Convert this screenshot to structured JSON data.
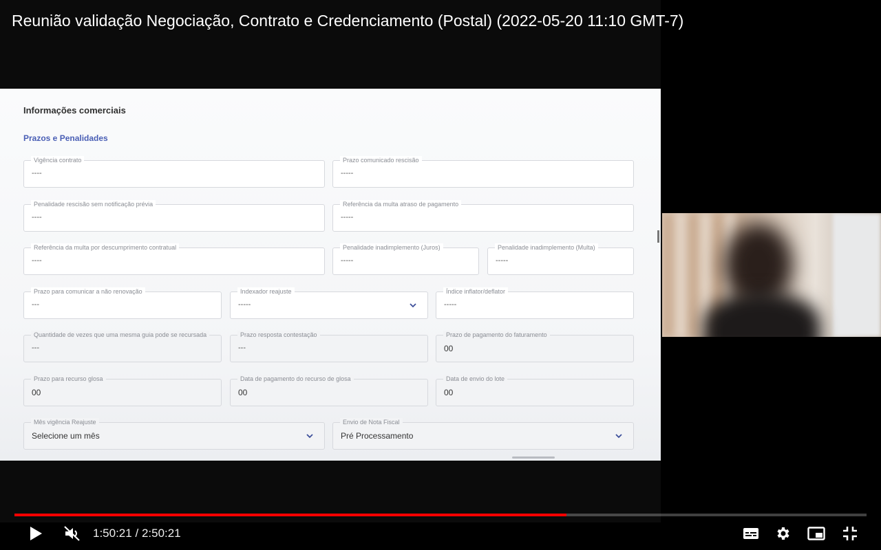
{
  "video": {
    "title": "Reunião validação Negociação, Contrato e Credenciamento (Postal) (2022-05-20 11:10 GMT-7)",
    "time_current": "1:50:21",
    "time_separator": "/",
    "time_total": "2:50:21",
    "progress": 0.6476,
    "accent_color": "#ff0000"
  },
  "form": {
    "section_title": "Informações comerciais",
    "subsection_title": "Prazos e Penalidades",
    "accent_color": "#4a5fb5",
    "fields": {
      "vigencia": {
        "label": "Vigência contrato",
        "value": "----"
      },
      "prazo_com_rescisao": {
        "label": "Prazo comunicado rescisão",
        "value": "-----"
      },
      "pen_rescisao": {
        "label": "Penalidade rescisão sem notificação prévia",
        "value": "----"
      },
      "ref_multa_atraso": {
        "label": "Referência da multa atraso de pagamento",
        "value": "-----"
      },
      "ref_multa_desc": {
        "label": "Referência da multa por descumprimento contratual",
        "value": "----"
      },
      "pen_juros": {
        "label": "Penalidade inadimplemento (Juros)",
        "value": "-----"
      },
      "pen_multa": {
        "label": "Penalidade inadimplemento (Multa)",
        "value": "-----"
      },
      "prazo_nao_renov": {
        "label": "Prazo para comunicar a não renovação",
        "value": "---"
      },
      "indexador": {
        "label": "Indexador reajuste",
        "value": "-----"
      },
      "indice": {
        "label": "Índice inflator/deflator",
        "value": "-----"
      },
      "qtd_guia": {
        "label": "Quantidade de vezes que uma mesma guia pode se recursada",
        "value": "---"
      },
      "prazo_contestacao": {
        "label": "Prazo resposta contestação",
        "value": "---"
      },
      "prazo_pag_fat": {
        "label": "Prazo de pagamento do faturamento",
        "value": "00"
      },
      "prazo_recurso": {
        "label": "Prazo para recurso glosa",
        "value": "00"
      },
      "data_pag_recurso": {
        "label": "Data de pagamento do recurso de glosa",
        "value": "00"
      },
      "data_envio_lote": {
        "label": "Data de envio do lote",
        "value": "00"
      },
      "mes_reajuste": {
        "label": "Mês vigência Reajuste",
        "value": "Selecione um mês"
      },
      "envio_nf": {
        "label": "Envio de Nota Fiscal",
        "value": "Pré Processamento"
      }
    }
  },
  "icons": {
    "play": "play-icon",
    "mute": "volume-muted-icon",
    "captions": "subtitles-icon",
    "settings": "gear-icon",
    "miniplayer": "miniplayer-icon",
    "fullscreen_exit": "exit-fullscreen-icon"
  }
}
